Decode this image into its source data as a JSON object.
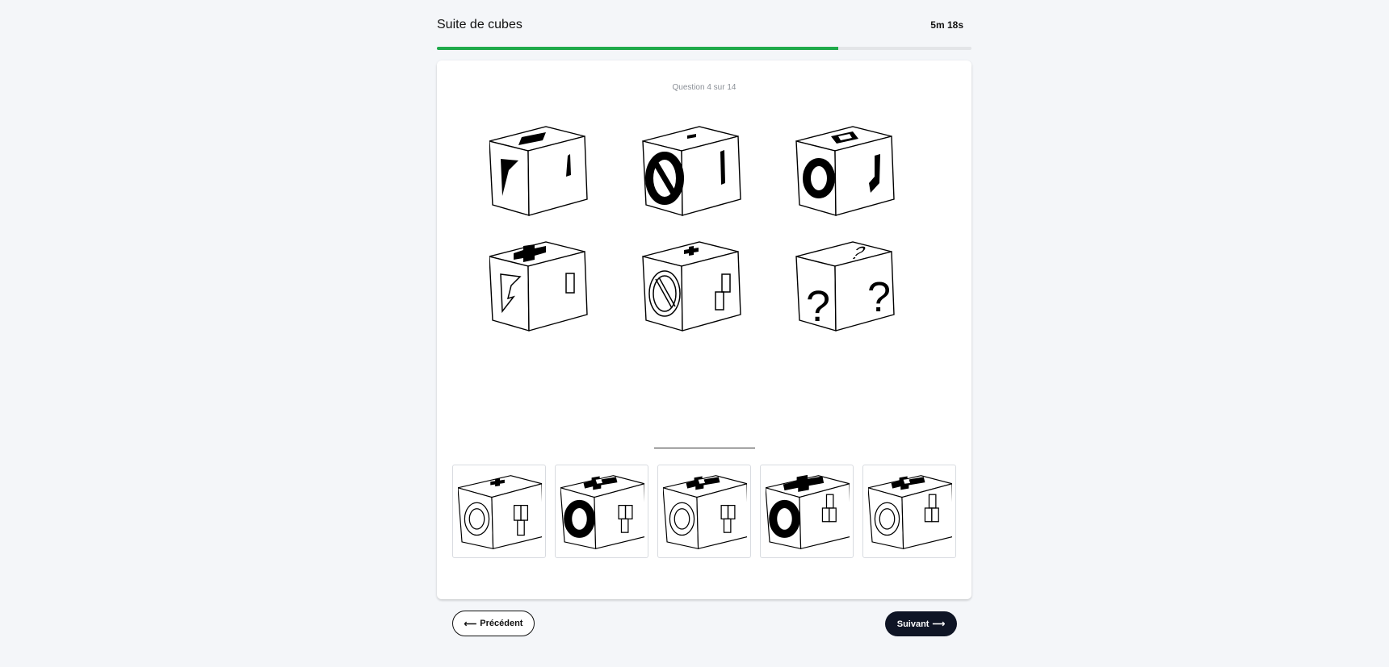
{
  "header": {
    "title": "Suite de cubes",
    "timer": "5m 18s",
    "progress": 0.75
  },
  "question": {
    "counter": "Question 4 sur 14"
  },
  "puzzle": {
    "row1": [
      "cube-top-bar-front-chevron-side-bar",
      "cube-top-dash-front-no-sign-side-bar",
      "cube-top-square-front-ring-side-hook"
    ],
    "row2": [
      "cube-top-cross-front-chevron-outline-side-rect-outline",
      "cube-top-cross-front-no-sign-outline-side-double-rect",
      "cube-unknown-question-marks"
    ]
  },
  "options": [
    {
      "id": "A",
      "icon": "cube-option-1-icon"
    },
    {
      "id": "B",
      "icon": "cube-option-2-icon"
    },
    {
      "id": "C",
      "icon": "cube-option-3-icon"
    },
    {
      "id": "D",
      "icon": "cube-option-4-icon"
    },
    {
      "id": "E",
      "icon": "cube-option-5-icon"
    }
  ],
  "nav": {
    "prev_label": "Précédent",
    "next_label": "Suivant",
    "prev_arrow": "⟵",
    "next_arrow": "⟶"
  }
}
